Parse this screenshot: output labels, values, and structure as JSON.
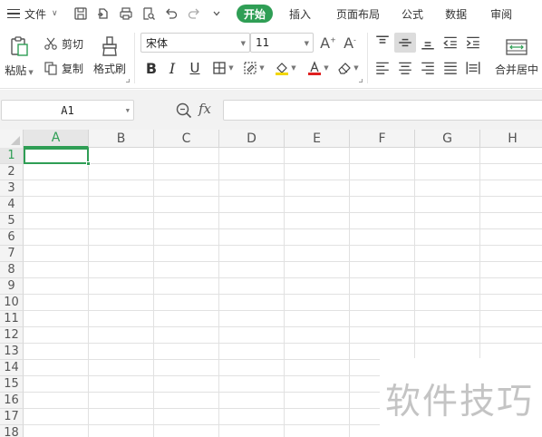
{
  "menubar": {
    "file_label": "文件",
    "tabs": [
      {
        "label": "开始",
        "active": true
      },
      {
        "label": "插入",
        "active": false
      },
      {
        "label": "页面布局",
        "active": false
      },
      {
        "label": "公式",
        "active": false
      },
      {
        "label": "数据",
        "active": false
      },
      {
        "label": "审阅",
        "active": false
      }
    ]
  },
  "ribbon": {
    "paste_label": "粘贴",
    "cut_label": "剪切",
    "copy_label": "复制",
    "format_painter_label": "格式刷",
    "font_name": "宋体",
    "font_size": "11",
    "merge_center_label": "合并居中",
    "accent_color": "#2f9e55",
    "highlight_color": "#f2d600",
    "font_color": "#e02020"
  },
  "formula_bar": {
    "name_box": "A1",
    "fx_label": "fx",
    "formula": ""
  },
  "sheet": {
    "columns": [
      "A",
      "B",
      "C",
      "D",
      "E",
      "F",
      "G",
      "H"
    ],
    "rows": [
      "1",
      "2",
      "3",
      "4",
      "5",
      "6",
      "7",
      "8",
      "9",
      "10",
      "11",
      "12",
      "13",
      "14",
      "15",
      "16",
      "17",
      "18"
    ],
    "selected_cell": "A1"
  },
  "watermark": "软件技巧"
}
